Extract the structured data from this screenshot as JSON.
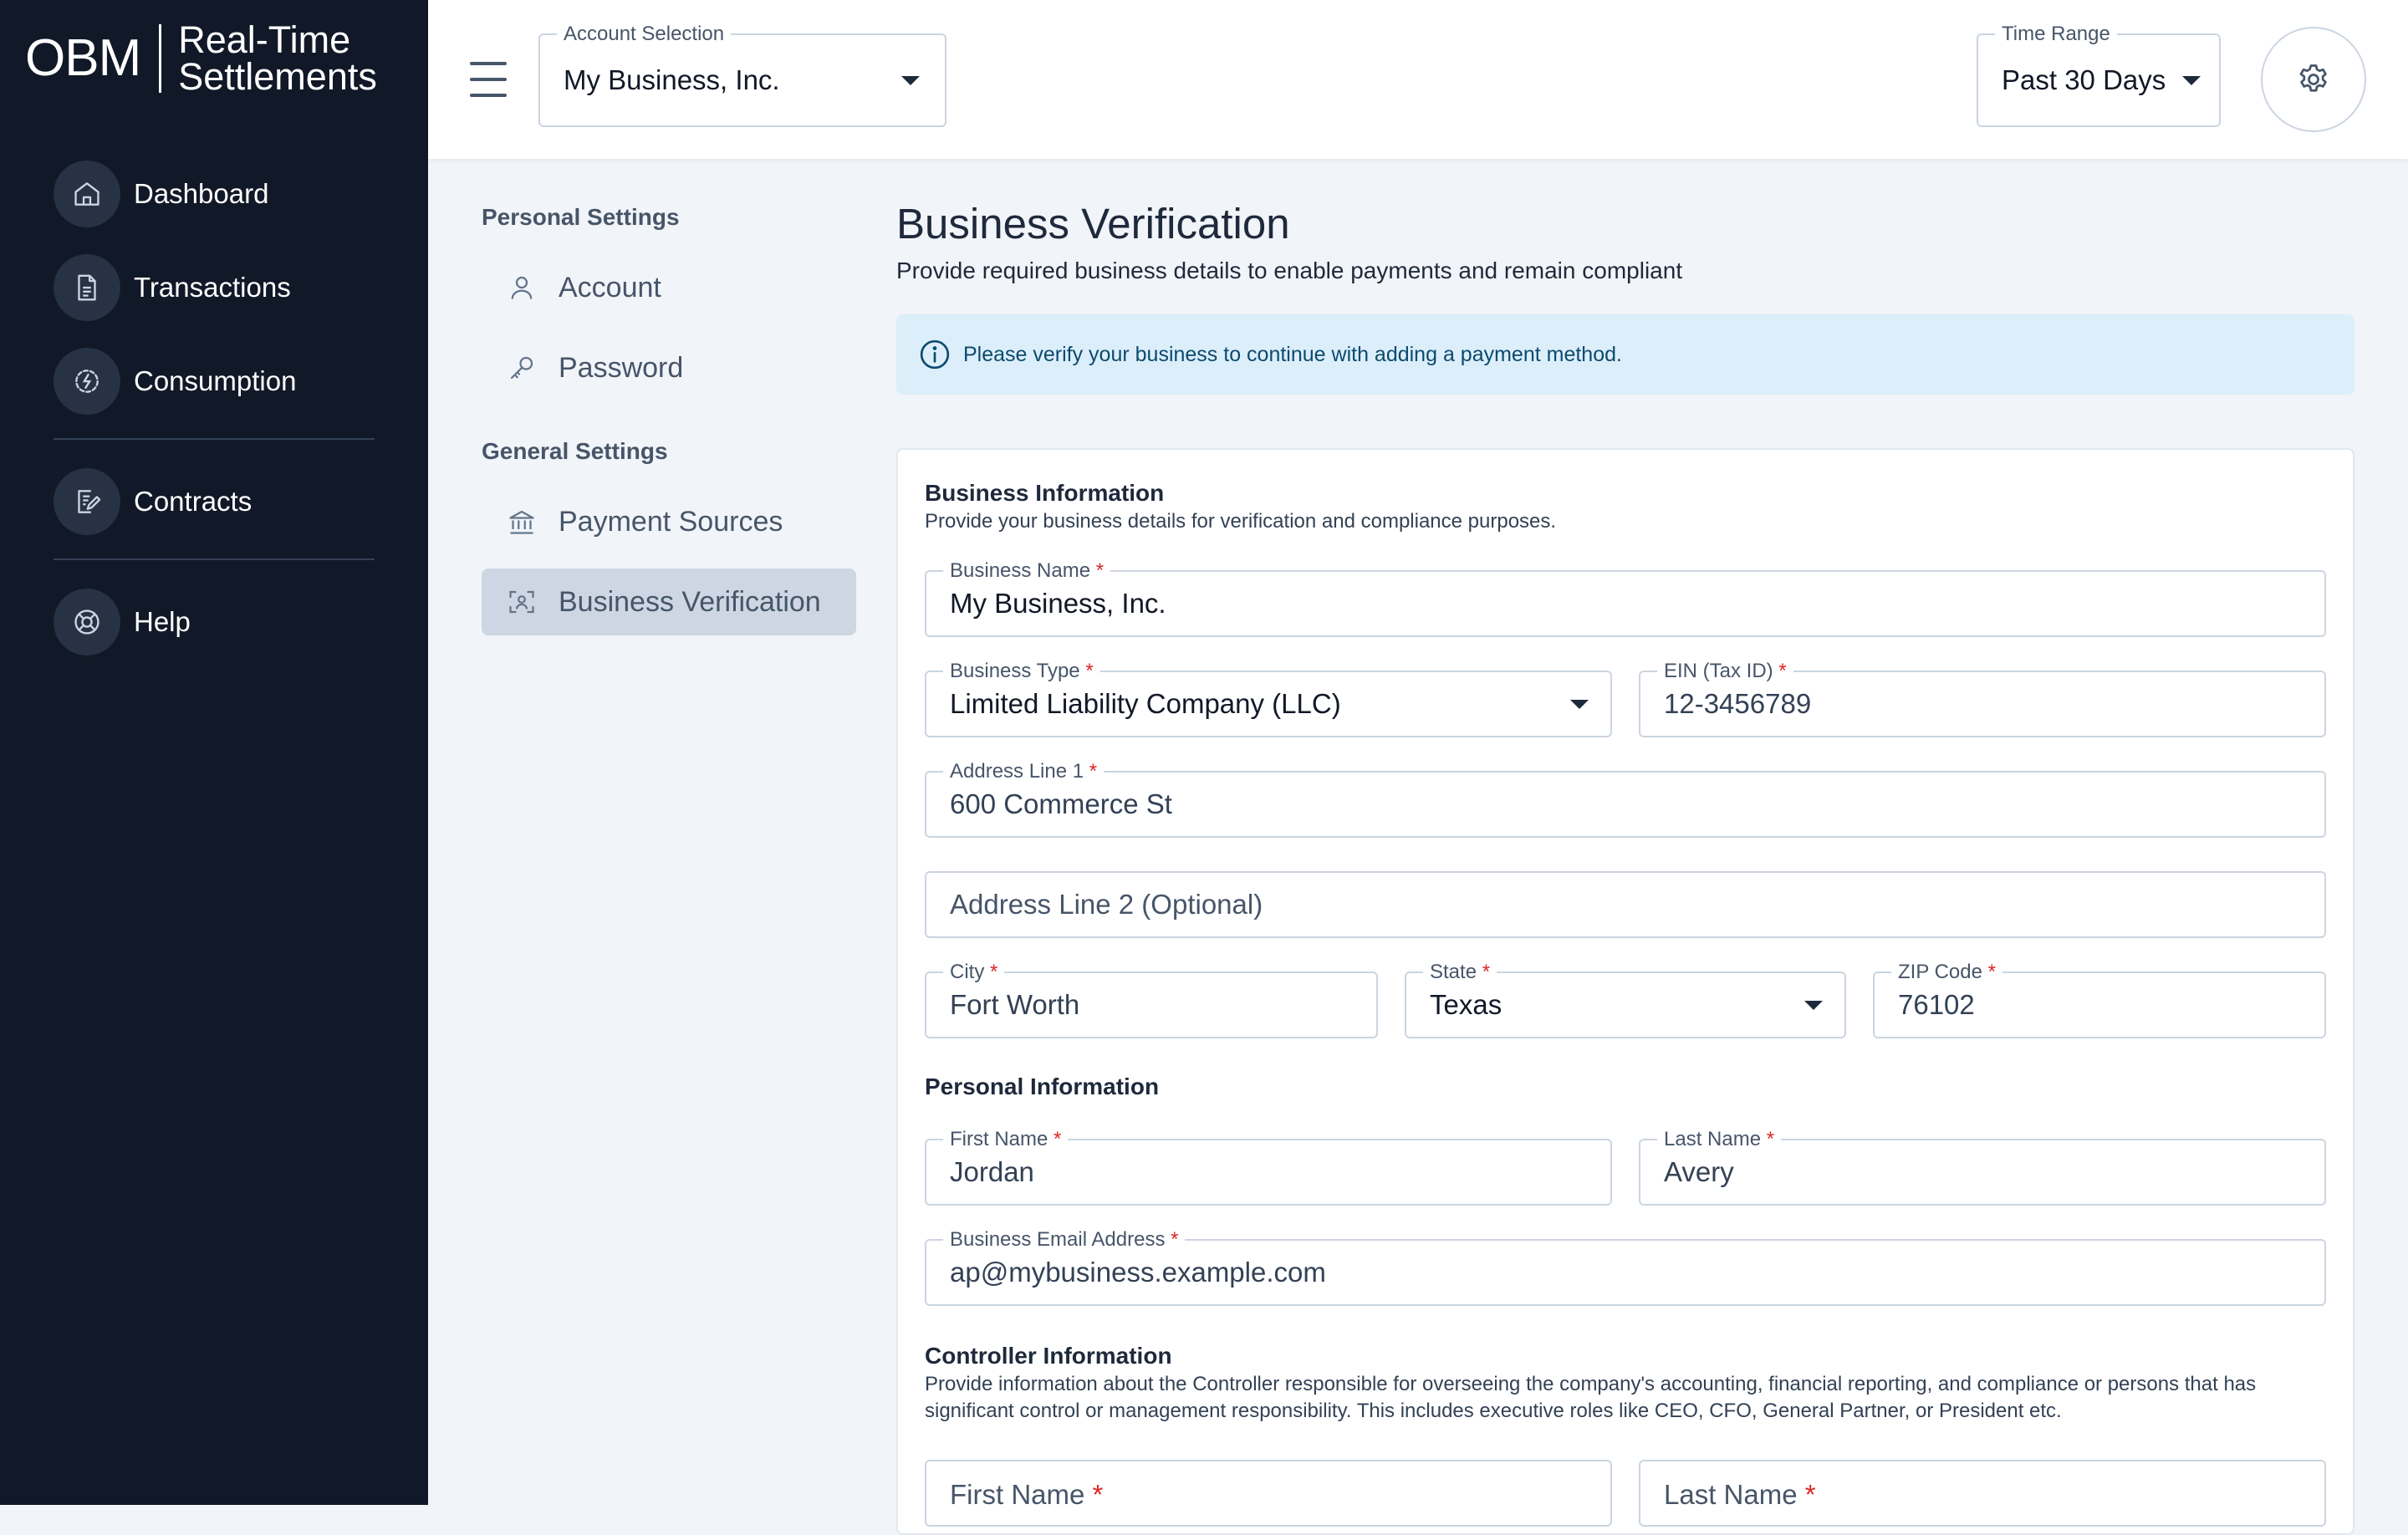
{
  "brand": {
    "mark": "OBM",
    "line1": "Real-Time",
    "line2": "Settlements"
  },
  "sidebar": {
    "items": [
      {
        "label": "Dashboard",
        "icon": "home-icon"
      },
      {
        "label": "Transactions",
        "icon": "document-icon"
      },
      {
        "label": "Consumption",
        "icon": "meter-icon"
      },
      {
        "label": "Contracts",
        "icon": "contract-icon"
      },
      {
        "label": "Help",
        "icon": "lifebuoy-icon"
      }
    ]
  },
  "topbar": {
    "account_label": "Account Selection",
    "account_value": "My Business, Inc.",
    "time_label": "Time Range",
    "time_value": "Past 30 Days"
  },
  "settings_nav": {
    "personal_heading": "Personal Settings",
    "general_heading": "General Settings",
    "items": [
      {
        "label": "Account",
        "icon": "user-icon"
      },
      {
        "label": "Password",
        "icon": "key-icon"
      },
      {
        "label": "Payment Sources",
        "icon": "bank-icon"
      },
      {
        "label": "Business Verification",
        "icon": "face-scan-icon",
        "active": true
      }
    ]
  },
  "page": {
    "title": "Business Verification",
    "subtitle": "Provide required business details to enable payments and remain compliant",
    "alert": "Please verify your business to continue with adding a payment method."
  },
  "form": {
    "business": {
      "title": "Business Information",
      "desc": "Provide your business details for verification and compliance purposes.",
      "business_name": {
        "label": "Business Name",
        "value": "My Business, Inc."
      },
      "business_type": {
        "label": "Business Type",
        "value": "Limited Liability Company (LLC)"
      },
      "ein": {
        "label": "EIN (Tax ID)",
        "value": "12-3456789"
      },
      "address1": {
        "label": "Address Line 1",
        "value": "600 Commerce St"
      },
      "address2": {
        "placeholder": "Address Line 2 (Optional)"
      },
      "city": {
        "label": "City",
        "value": "Fort Worth"
      },
      "state": {
        "label": "State",
        "value": "Texas"
      },
      "zip": {
        "label": "ZIP Code",
        "value": "76102"
      }
    },
    "personal": {
      "title": "Personal Information",
      "first_name": {
        "label": "First Name",
        "value": "Jordan"
      },
      "last_name": {
        "label": "Last Name",
        "value": "Avery"
      },
      "email": {
        "label": "Business Email Address",
        "value": "ap@mybusiness.example.com"
      }
    },
    "controller": {
      "title": "Controller Information",
      "desc": "Provide information about the Controller responsible for overseeing the company's accounting, financial reporting, and compliance or persons that has significant control or management responsibility. This includes executive roles like CEO, CFO, General Partner, or President etc.",
      "first_name_placeholder": "First Name",
      "last_name_placeholder": "Last Name"
    },
    "required_mark": "*"
  }
}
